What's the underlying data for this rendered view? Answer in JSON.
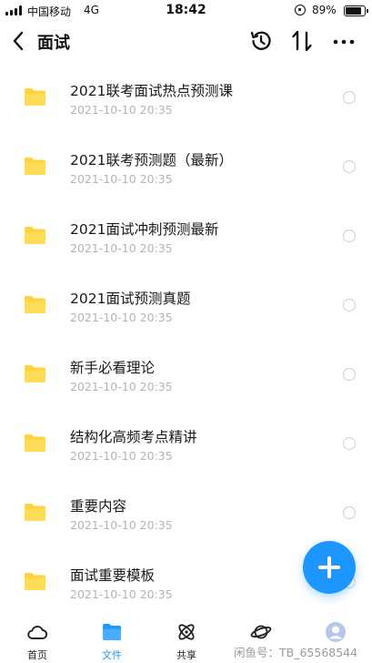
{
  "status_bar": {
    "carrier": "中国移动",
    "network": "4G",
    "time": "18:42",
    "battery_percent": "89%",
    "battery_level": 0.89
  },
  "header": {
    "title": "面试",
    "back_icon": "chevron-left-icon",
    "history_icon": "history-icon",
    "sort_icon": "sort-icon",
    "more_icon": "more-icon"
  },
  "files": [
    {
      "name": "2021联考面试热点预测课",
      "date": "2021-10-10 20:35"
    },
    {
      "name": "2021联考预测题（最新）",
      "date": "2021-10-10 20:35"
    },
    {
      "name": "2021面试冲刺预测最新",
      "date": "2021-10-10 20:35"
    },
    {
      "name": "2021面试预测真题",
      "date": "2021-10-10 20:35"
    },
    {
      "name": "新手必看理论",
      "date": "2021-10-10 20:35"
    },
    {
      "name": "结构化高频考点精讲",
      "date": "2021-10-10 20:35"
    },
    {
      "name": "重要内容",
      "date": "2021-10-10 20:35"
    },
    {
      "name": "面试重要模板",
      "date": "2021-10-10 20:35"
    }
  ],
  "fab": {
    "icon": "plus-icon"
  },
  "tabs": [
    {
      "label": "首页",
      "icon": "cloud-icon"
    },
    {
      "label": "文件",
      "icon": "folder-icon"
    },
    {
      "label": "共享",
      "icon": "atom-icon"
    },
    {
      "label": "",
      "icon": "planet-icon"
    },
    {
      "label": "",
      "icon": "avatar-icon"
    }
  ],
  "watermark": "闲鱼号：TB_65568544",
  "colors": {
    "accent": "#1e96ff",
    "folder": "#ffd23c",
    "date_text": "#b4b4b4"
  }
}
